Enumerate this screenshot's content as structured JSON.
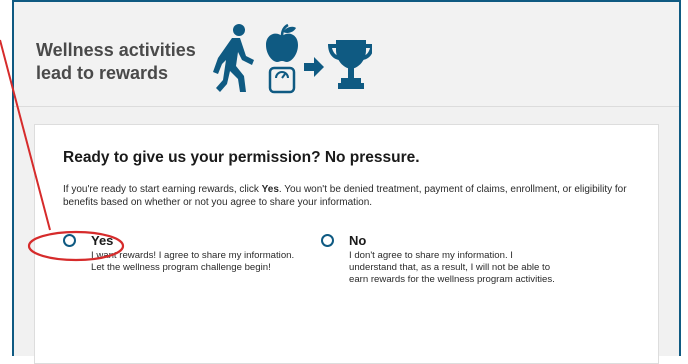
{
  "header": {
    "title": "Wellness activities lead to rewards",
    "icons": [
      "walking-person-icon",
      "apple-icon",
      "scale-icon",
      "arrow-right-icon",
      "trophy-icon"
    ]
  },
  "permission": {
    "title": "Ready to give us your permission? No pressure.",
    "intro_before": "If you're ready to start earning rewards, click ",
    "intro_bold": "Yes",
    "intro_after": ". You won't be denied treatment, payment of claims, enrollment, or eligibility for benefits based on whether or not you agree to share your information.",
    "options": [
      {
        "label": "Yes",
        "description": "I want rewards! I agree to share my information. Let the wellness program challenge begin!",
        "selected": false
      },
      {
        "label": "No",
        "description": "I don't agree to share my information. I understand that, as a result, I will not be able to earn rewards for the wellness program activities.",
        "selected": false
      }
    ]
  },
  "colors": {
    "accent": "#0f5a82",
    "annotation": "#d62b2b"
  }
}
